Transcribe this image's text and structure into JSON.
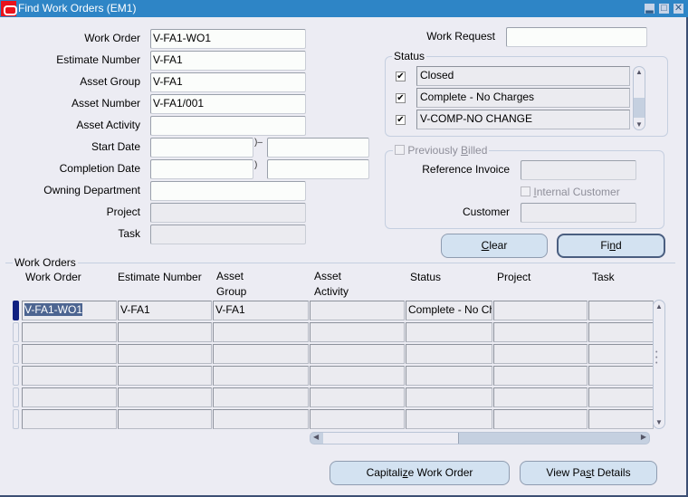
{
  "window": {
    "title": "Find Work Orders (EM1)",
    "controls": [
      "minimize",
      "maximize",
      "close"
    ]
  },
  "form": {
    "work_order": {
      "label": "Work Order",
      "value": "V-FA1-WO1"
    },
    "estimate_number": {
      "label": "Estimate Number",
      "value": "V-FA1"
    },
    "asset_group": {
      "label": "Asset Group",
      "value": "V-FA1"
    },
    "asset_number": {
      "label": "Asset Number",
      "value": "V-FA1/001"
    },
    "asset_activity": {
      "label": "Asset Activity",
      "value": ""
    },
    "start_date": {
      "label": "Start Date",
      "from": "",
      "to": ""
    },
    "completion_date": {
      "label": "Completion Date",
      "from": "",
      "to": ""
    },
    "owning_department": {
      "label": "Owning Department",
      "value": ""
    },
    "project": {
      "label": "Project",
      "value": ""
    },
    "task": {
      "label": "Task",
      "value": ""
    },
    "work_request": {
      "label": "Work Request",
      "value": ""
    }
  },
  "status": {
    "title": "Status",
    "items": [
      {
        "label": "Closed",
        "checked": true
      },
      {
        "label": "Complete - No Charges",
        "checked": true
      },
      {
        "label": "V-COMP-NO CHANGE",
        "checked": true
      }
    ]
  },
  "billing": {
    "previously_billed": {
      "label_pre": "Previously ",
      "mnemonic": "B",
      "label_post": "illed",
      "checked": false
    },
    "reference_invoice": {
      "label": "Reference Invoice",
      "value": ""
    },
    "internal_customer": {
      "label_pre": "",
      "mnemonic": "I",
      "label_post": "nternal Customer",
      "checked": false
    },
    "customer": {
      "label": "Customer",
      "value": ""
    }
  },
  "buttons": {
    "clear": {
      "mnemonic": "C",
      "rest": "lear"
    },
    "find": {
      "pre": "Fi",
      "mnemonic": "n",
      "post": "d"
    },
    "capitalize": {
      "pre": "Capitali",
      "mnemonic": "z",
      "post": "e Work Order"
    },
    "view_past": {
      "pre": "View Pa",
      "mnemonic": "s",
      "post": "t Details"
    }
  },
  "work_orders": {
    "title": "Work Orders",
    "columns": [
      {
        "line1": "",
        "line2": "Work Order"
      },
      {
        "line1": "",
        "line2": "Estimate Number"
      },
      {
        "line1": "Asset",
        "line2": "Group"
      },
      {
        "line1": "Asset",
        "line2": "Activity"
      },
      {
        "line1": "",
        "line2": "Status"
      },
      {
        "line1": "",
        "line2": "Project"
      },
      {
        "line1": "",
        "line2": "Task"
      }
    ],
    "rows": [
      [
        "V-FA1-WO1",
        "V-FA1",
        "V-FA1",
        "",
        "Complete - No Charges",
        "",
        ""
      ],
      [
        "",
        "",
        "",
        "",
        "",
        "",
        ""
      ],
      [
        "",
        "",
        "",
        "",
        "",
        "",
        ""
      ],
      [
        "",
        "",
        "",
        "",
        "",
        "",
        ""
      ],
      [
        "",
        "",
        "",
        "",
        "",
        "",
        ""
      ],
      [
        "",
        "",
        "",
        "",
        "",
        "",
        ""
      ]
    ]
  }
}
